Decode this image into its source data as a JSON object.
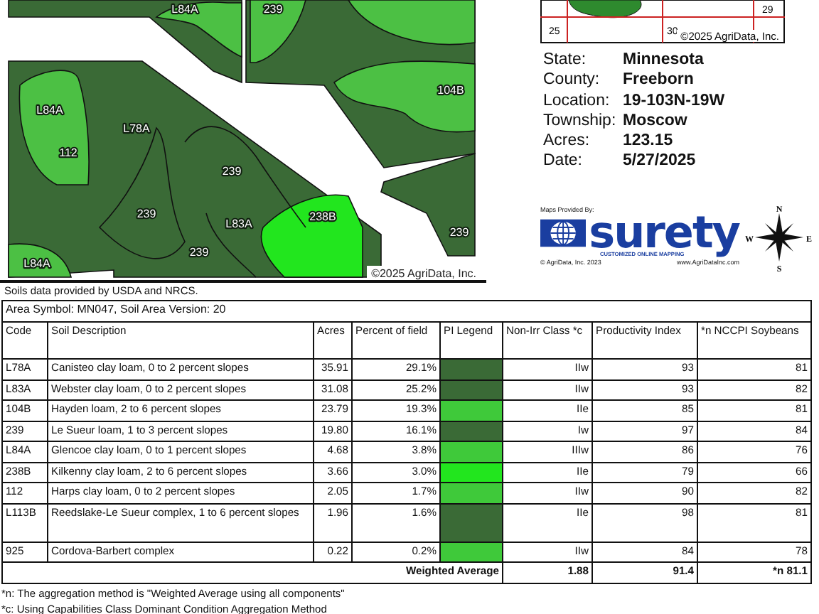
{
  "soil_map": {
    "labels": [
      "L84A",
      "239",
      "104B",
      "L84A",
      "L78A",
      "112",
      "239",
      "239",
      "L83A",
      "238B",
      "239",
      "239",
      "L84A"
    ],
    "copyright": "©2025 AgriData, Inc.",
    "source_note": "Soils data provided by USDA and NRCS."
  },
  "location_map": {
    "labels": [
      "25",
      "30",
      "29"
    ],
    "copyright": "©2025 AgriData, Inc."
  },
  "info": [
    {
      "label": "State:",
      "value": "Minnesota"
    },
    {
      "label": "County:",
      "value": "Freeborn"
    },
    {
      "label": "Location:",
      "value": "19-103N-19W"
    },
    {
      "label": "Township:",
      "value": "Moscow"
    },
    {
      "label": "Acres:",
      "value": "123.15"
    },
    {
      "label": "Date:",
      "value": "5/27/2025"
    }
  ],
  "provider": {
    "caption": "Maps Provided By:",
    "brand": "surety",
    "tagline": "CUSTOMIZED ONLINE MAPPING",
    "copyright": "© AgriData, Inc. 2023",
    "website": "www.AgriDataInc.com"
  },
  "compass": {
    "north": "N",
    "east": "E",
    "south": "S",
    "west": "W"
  },
  "soil_table": {
    "area_title": "Area Symbol: MN047, Soil Area Version: 20",
    "columns": [
      "Code",
      "Soil Description",
      "Acres",
      "Percent of field",
      "PI Legend",
      "Non-Irr Class *c",
      "Productivity Index",
      "*n NCCPI Soybeans"
    ],
    "rows": [
      {
        "code": "L78A",
        "description": "Canisteo clay loam, 0 to 2 percent slopes",
        "acres": "35.91",
        "percent": "29.1%",
        "color": "#3a6a36",
        "non_irr_class": "IIw",
        "productivity_index": "93",
        "nccpi": "81"
      },
      {
        "code": "L83A",
        "description": "Webster clay loam, 0 to 2 percent slopes",
        "acres": "31.08",
        "percent": "25.2%",
        "color": "#3a6a36",
        "non_irr_class": "IIw",
        "productivity_index": "93",
        "nccpi": "82"
      },
      {
        "code": "104B",
        "description": "Hayden loam, 2 to 6 percent slopes",
        "acres": "23.79",
        "percent": "19.3%",
        "color": "#3fc93a",
        "non_irr_class": "IIe",
        "productivity_index": "85",
        "nccpi": "81"
      },
      {
        "code": "239",
        "description": "Le Sueur loam, 1 to 3 percent slopes",
        "acres": "19.80",
        "percent": "16.1%",
        "color": "#3a6a36",
        "non_irr_class": "Iw",
        "productivity_index": "97",
        "nccpi": "84"
      },
      {
        "code": "L84A",
        "description": "Glencoe clay loam, 0 to 1 percent slopes",
        "acres": "4.68",
        "percent": "3.8%",
        "color": "#3fc93a",
        "non_irr_class": "IIIw",
        "productivity_index": "86",
        "nccpi": "76"
      },
      {
        "code": "238B",
        "description": "Kilkenny clay loam, 2 to 6 percent slopes",
        "acres": "3.66",
        "percent": "3.0%",
        "color": "#22e61e",
        "non_irr_class": "IIe",
        "productivity_index": "79",
        "nccpi": "66"
      },
      {
        "code": "112",
        "description": "Harps clay loam, 0 to 2 percent slopes",
        "acres": "2.05",
        "percent": "1.7%",
        "color": "#3fc93a",
        "non_irr_class": "IIw",
        "productivity_index": "90",
        "nccpi": "82"
      },
      {
        "code": "L113B",
        "description": "Reedslake-Le Sueur complex, 1 to 6 percent slopes",
        "acres": "1.96",
        "percent": "1.6%",
        "color": "#3a6a36",
        "non_irr_class": "IIe",
        "productivity_index": "98",
        "nccpi": "81"
      },
      {
        "code": "925",
        "description": "Cordova-Barbert complex",
        "acres": "0.22",
        "percent": "0.2%",
        "color": "#3fc93a",
        "non_irr_class": "IIw",
        "productivity_index": "84",
        "nccpi": "78"
      }
    ],
    "weighted_average": {
      "label": "Weighted Average",
      "non_irr_class": "1.88",
      "productivity_index": "91.4",
      "nccpi": "*n 81.1"
    }
  },
  "footnotes": [
    "*n: The aggregation method is \"Weighted Average using all components\"",
    "*c: Using Capabilities Class Dominant Condition Aggregation Method"
  ]
}
